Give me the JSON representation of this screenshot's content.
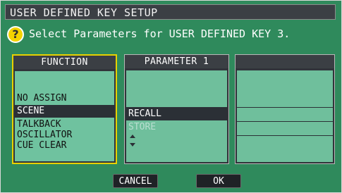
{
  "title": "USER DEFINED KEY SETUP",
  "prompt": "Select Parameters for USER DEFINED KEY 3.",
  "function_panel": {
    "header": "FUNCTION",
    "items": [
      "NO ASSIGN",
      "SCENE",
      "TALKBACK",
      "OSCILLATOR",
      "CUE CLEAR"
    ],
    "selected": "SCENE"
  },
  "parameter1_panel": {
    "header": "PARAMETER 1",
    "items": [
      "RECALL",
      "STORE"
    ],
    "selected": "RECALL"
  },
  "parameter2_panel": {
    "header": ""
  },
  "buttons": {
    "cancel": "CANCEL",
    "ok": "OK"
  },
  "icons": {
    "help": "help-icon",
    "scroll_up": "scroll-up-arrow-icon",
    "scroll_down": "scroll-down-arrow-icon"
  },
  "colors": {
    "background": "#2f8a5c",
    "list": "#6fc29f",
    "selection": "#2b3036",
    "focus": "#e8d100"
  }
}
